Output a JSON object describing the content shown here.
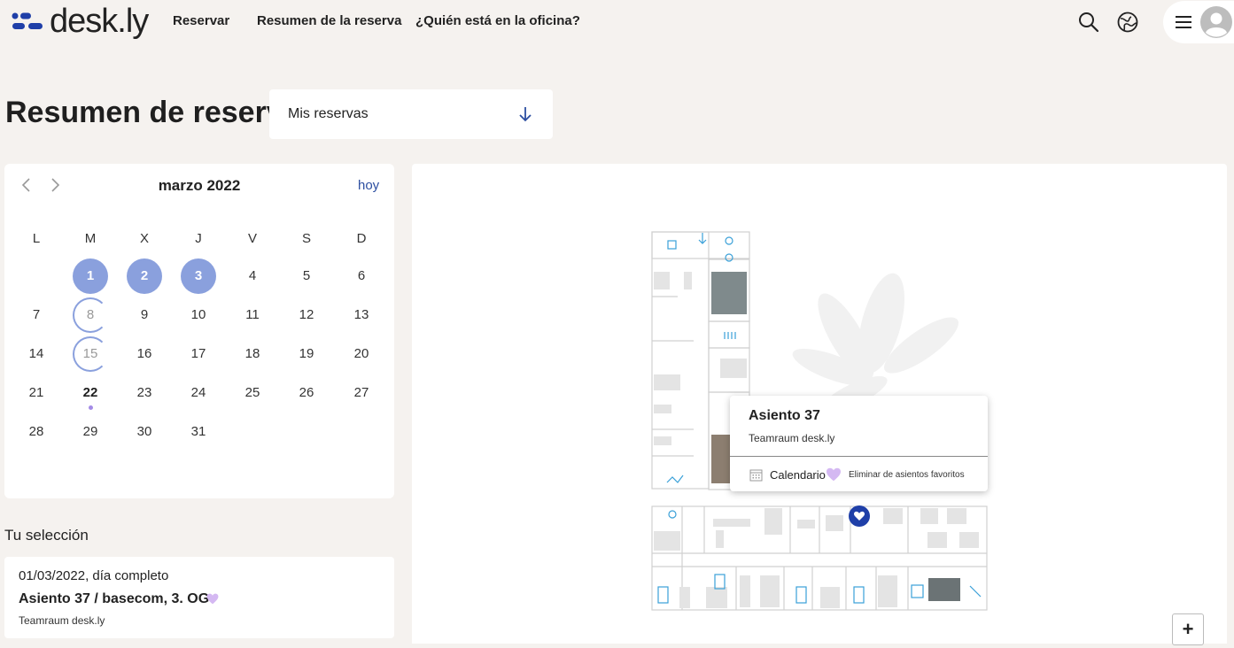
{
  "header": {
    "logo_text": "desk.ly",
    "nav": [
      "Reservar",
      "Resumen de la reserva",
      "¿Quién está en la oficina?"
    ],
    "icons": [
      "search-icon",
      "globe-icon",
      "hamburger-menu-icon",
      "user-avatar-icon"
    ]
  },
  "page": {
    "title": "Resumen de reserva",
    "filter": {
      "value": "Mis reservas"
    }
  },
  "calendar": {
    "month": "marzo 2022",
    "today_label": "hoy",
    "weekdays": [
      "L",
      "M",
      "X",
      "J",
      "V",
      "S",
      "D"
    ],
    "weeks": [
      [
        "",
        "1",
        "2",
        "3",
        "4",
        "5",
        "6"
      ],
      [
        "7",
        "8",
        "9",
        "10",
        "11",
        "12",
        "13"
      ],
      [
        "14",
        "15",
        "16",
        "17",
        "18",
        "19",
        "20"
      ],
      [
        "21",
        "22",
        "23",
        "24",
        "25",
        "26",
        "27"
      ],
      [
        "28",
        "29",
        "30",
        "31",
        "",
        "",
        ""
      ]
    ],
    "booked_days": [
      "1",
      "2",
      "3"
    ],
    "partial_days": [
      "8",
      "15"
    ],
    "today": "22",
    "booked_color": "#8aa0dd"
  },
  "selection": {
    "heading": "Tu selección",
    "date": "01/03/2022, día completo",
    "seat": "Asiento 37 / basecom, 3. OG",
    "room": "Teamraum desk.ly"
  },
  "map": {
    "zoom_in_label": "+",
    "accent_color": "#3aa0d8",
    "selected_seat_color": "#1f3fa8",
    "popup": {
      "title": "Asiento 37",
      "subtitle": "Teamraum desk.ly",
      "calendar_label": "Calendario",
      "remove_favorite_label": "Eliminar de asientos favoritos"
    }
  }
}
